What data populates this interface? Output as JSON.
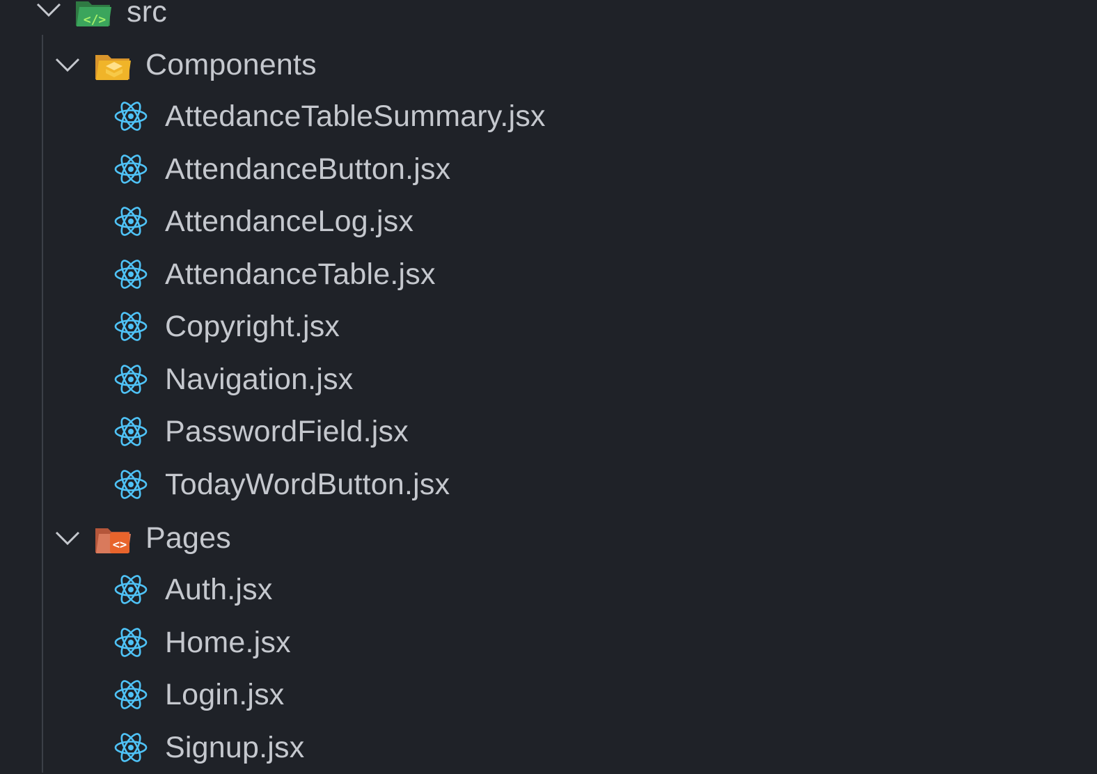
{
  "tree": {
    "root": {
      "label": "src",
      "icon": "src-folder-icon",
      "expanded": true,
      "icon_color": "#3ba55c"
    },
    "folders": [
      {
        "label": "Components",
        "icon": "components-folder-icon",
        "expanded": true,
        "icon_color": "#f0b429",
        "files": [
          {
            "label": "AttedanceTableSummary.jsx",
            "icon": "react-icon"
          },
          {
            "label": "AttendanceButton.jsx",
            "icon": "react-icon"
          },
          {
            "label": "AttendanceLog.jsx",
            "icon": "react-icon"
          },
          {
            "label": "AttendanceTable.jsx",
            "icon": "react-icon"
          },
          {
            "label": "Copyright.jsx",
            "icon": "react-icon"
          },
          {
            "label": "Navigation.jsx",
            "icon": "react-icon"
          },
          {
            "label": "PasswordField.jsx",
            "icon": "react-icon"
          },
          {
            "label": "TodayWordButton.jsx",
            "icon": "react-icon"
          }
        ]
      },
      {
        "label": "Pages",
        "icon": "pages-folder-icon",
        "expanded": true,
        "icon_color": "#e8642c",
        "files": [
          {
            "label": "Auth.jsx",
            "icon": "react-icon"
          },
          {
            "label": "Home.jsx",
            "icon": "react-icon"
          },
          {
            "label": "Login.jsx",
            "icon": "react-icon"
          },
          {
            "label": "Signup.jsx",
            "icon": "react-icon"
          }
        ]
      }
    ]
  },
  "colors": {
    "background": "#1f2228",
    "text": "#c5c8ce",
    "react": "#4fc3f7",
    "chevron": "#c5c8ce"
  }
}
